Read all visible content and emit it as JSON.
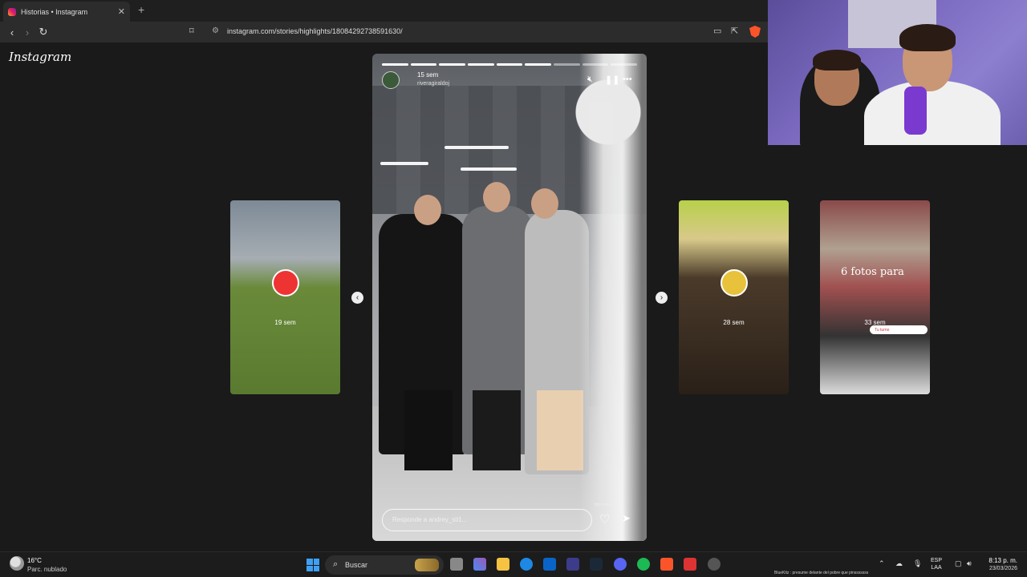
{
  "browser": {
    "tab_title": "Historias • Instagram",
    "tab_close": "✕",
    "new_tab": "+",
    "url": "instagram.com/stories/highlights/18084292738591630/"
  },
  "instagram": {
    "logo": "Instagram",
    "current_story": {
      "time": "15 sem",
      "username": "riveragiraldoj",
      "reply_placeholder": "Responde a andrey_sti1...",
      "sticker_user": "bjcrnn.itzel",
      "segments": 9,
      "active_segments": 6
    },
    "prev_story": {
      "time": "19 sem"
    },
    "next_stories": [
      {
        "time": "28 sem"
      },
      {
        "time": "33 sem",
        "overlay_text": "6 fotos para",
        "pill_text": "Tu turno"
      }
    ]
  },
  "taskbar": {
    "weather_temp": "16°C",
    "weather_desc": "Parc. nublado",
    "search_label": "Buscar",
    "lang_top": "ESP",
    "lang_bottom": "LAA",
    "time": "8:13 p. m.",
    "date": "23/03/2026",
    "ticker": "BlueKitz : presume delante del pobre que pinsssssss"
  },
  "icons": {
    "back": "back-arrow-icon",
    "forward": "forward-arrow-icon",
    "reload": "reload-icon",
    "brand_color": "#fb542b",
    "windows_blue": "#3ea0f5"
  }
}
